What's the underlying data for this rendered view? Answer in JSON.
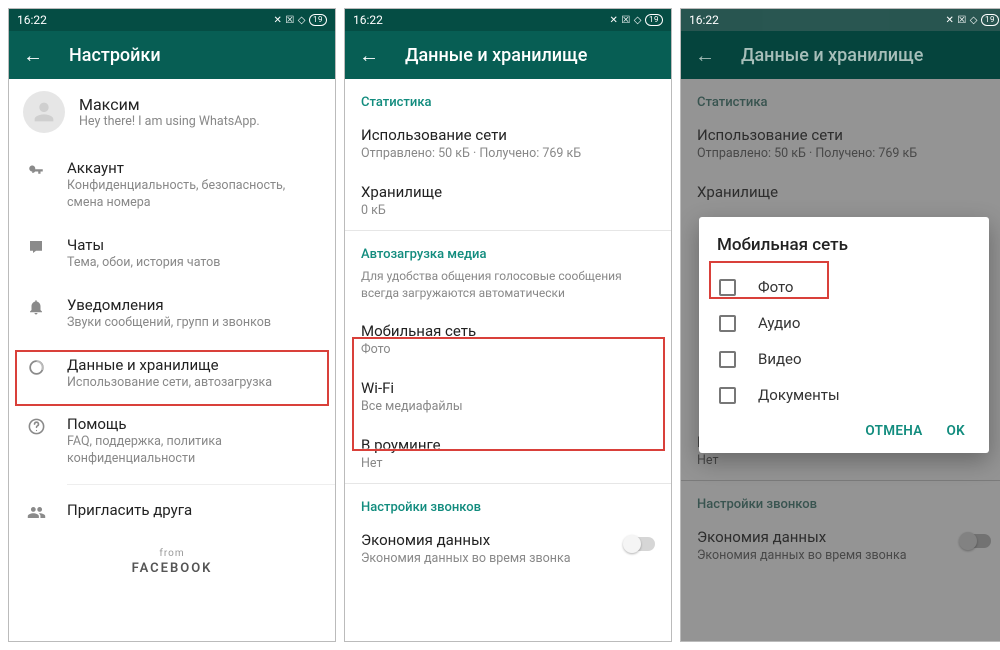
{
  "status": {
    "time": "16:22",
    "battery": "19"
  },
  "screen1": {
    "title": "Настройки",
    "profile": {
      "name": "Максим",
      "status": "Hey there! I am using WhatsApp."
    },
    "items": [
      {
        "title": "Аккаунт",
        "sub": "Конфиденциальность, безопасность, смена номера"
      },
      {
        "title": "Чаты",
        "sub": "Тема, обои, история чатов"
      },
      {
        "title": "Уведомления",
        "sub": "Звуки сообщений, групп и звонков"
      },
      {
        "title": "Данные и хранилище",
        "sub": "Использование сети, автозагрузка"
      },
      {
        "title": "Помощь",
        "sub": "FAQ, поддержка, политика конфиденциальности"
      },
      {
        "title": "Пригласить друга",
        "sub": ""
      }
    ],
    "from": "from",
    "fb": "FACEBOOK"
  },
  "screen2": {
    "title": "Данные и хранилище",
    "sec_stats": "Статистика",
    "net_usage": {
      "title": "Использование сети",
      "sub": "Отправлено: 50 кБ · Получено: 769 кБ"
    },
    "storage": {
      "title": "Хранилище",
      "sub": "0 кБ"
    },
    "sec_auto": "Автозагрузка медиа",
    "sec_auto_sub": "Для удобства общения голосовые сообщения всегда загружаются автоматически",
    "mobile": {
      "title": "Мобильная сеть",
      "sub": "Фото"
    },
    "wifi": {
      "title": "Wi-Fi",
      "sub": "Все медиафайлы"
    },
    "roaming": {
      "title": "В роуминге",
      "sub": "Нет"
    },
    "sec_calls": "Настройки звонков",
    "data_saver": {
      "title": "Экономия данных",
      "sub": "Экономия данных во время звонка"
    }
  },
  "screen3": {
    "title": "Данные и хранилище",
    "dialog_title": "Мобильная сеть",
    "options": [
      "Фото",
      "Аудио",
      "Видео",
      "Документы"
    ],
    "cancel": "ОТМЕНА",
    "ok": "OK"
  }
}
